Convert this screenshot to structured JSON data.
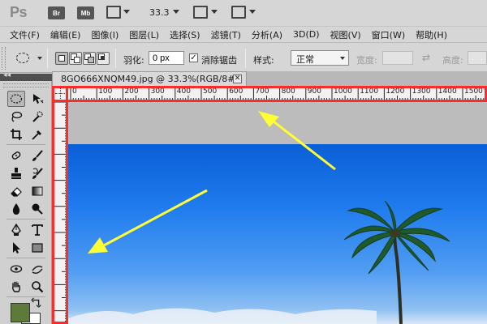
{
  "app": {
    "logo": "Ps",
    "bridge_btn": "Br",
    "minibridge_btn": "Mb",
    "zoom": "33.3"
  },
  "menu": [
    "文件(F)",
    "编辑(E)",
    "图像(I)",
    "图层(L)",
    "选择(S)",
    "滤镜(T)",
    "分析(A)",
    "3D(D)",
    "视图(V)",
    "窗口(W)",
    "帮助(H)"
  ],
  "options": {
    "feather_label": "羽化:",
    "feather_value": "0 px",
    "antialias_label": "消除锯齿",
    "antialias_checked": "✓",
    "style_label": "样式:",
    "style_value": "正常",
    "width_label": "宽度:",
    "height_label": "高度:"
  },
  "panel": {
    "collapse_glyph": "◂◂"
  },
  "document": {
    "tab_title": "8GO666XNQM49.jpg @ 33.3%(RGB/8#)",
    "close_glyph": "✕"
  },
  "ruler": {
    "labels": [
      "0",
      "100",
      "200",
      "300",
      "400",
      "500",
      "600",
      "700",
      "800",
      "900",
      "1000",
      "1100",
      "1200",
      "1300",
      "1400",
      "1500"
    ]
  },
  "colors": {
    "foreground": "#5d7a3b",
    "background": "#ffffff",
    "highlight": "#ff2b2b",
    "arrow": "#ffff33"
  }
}
